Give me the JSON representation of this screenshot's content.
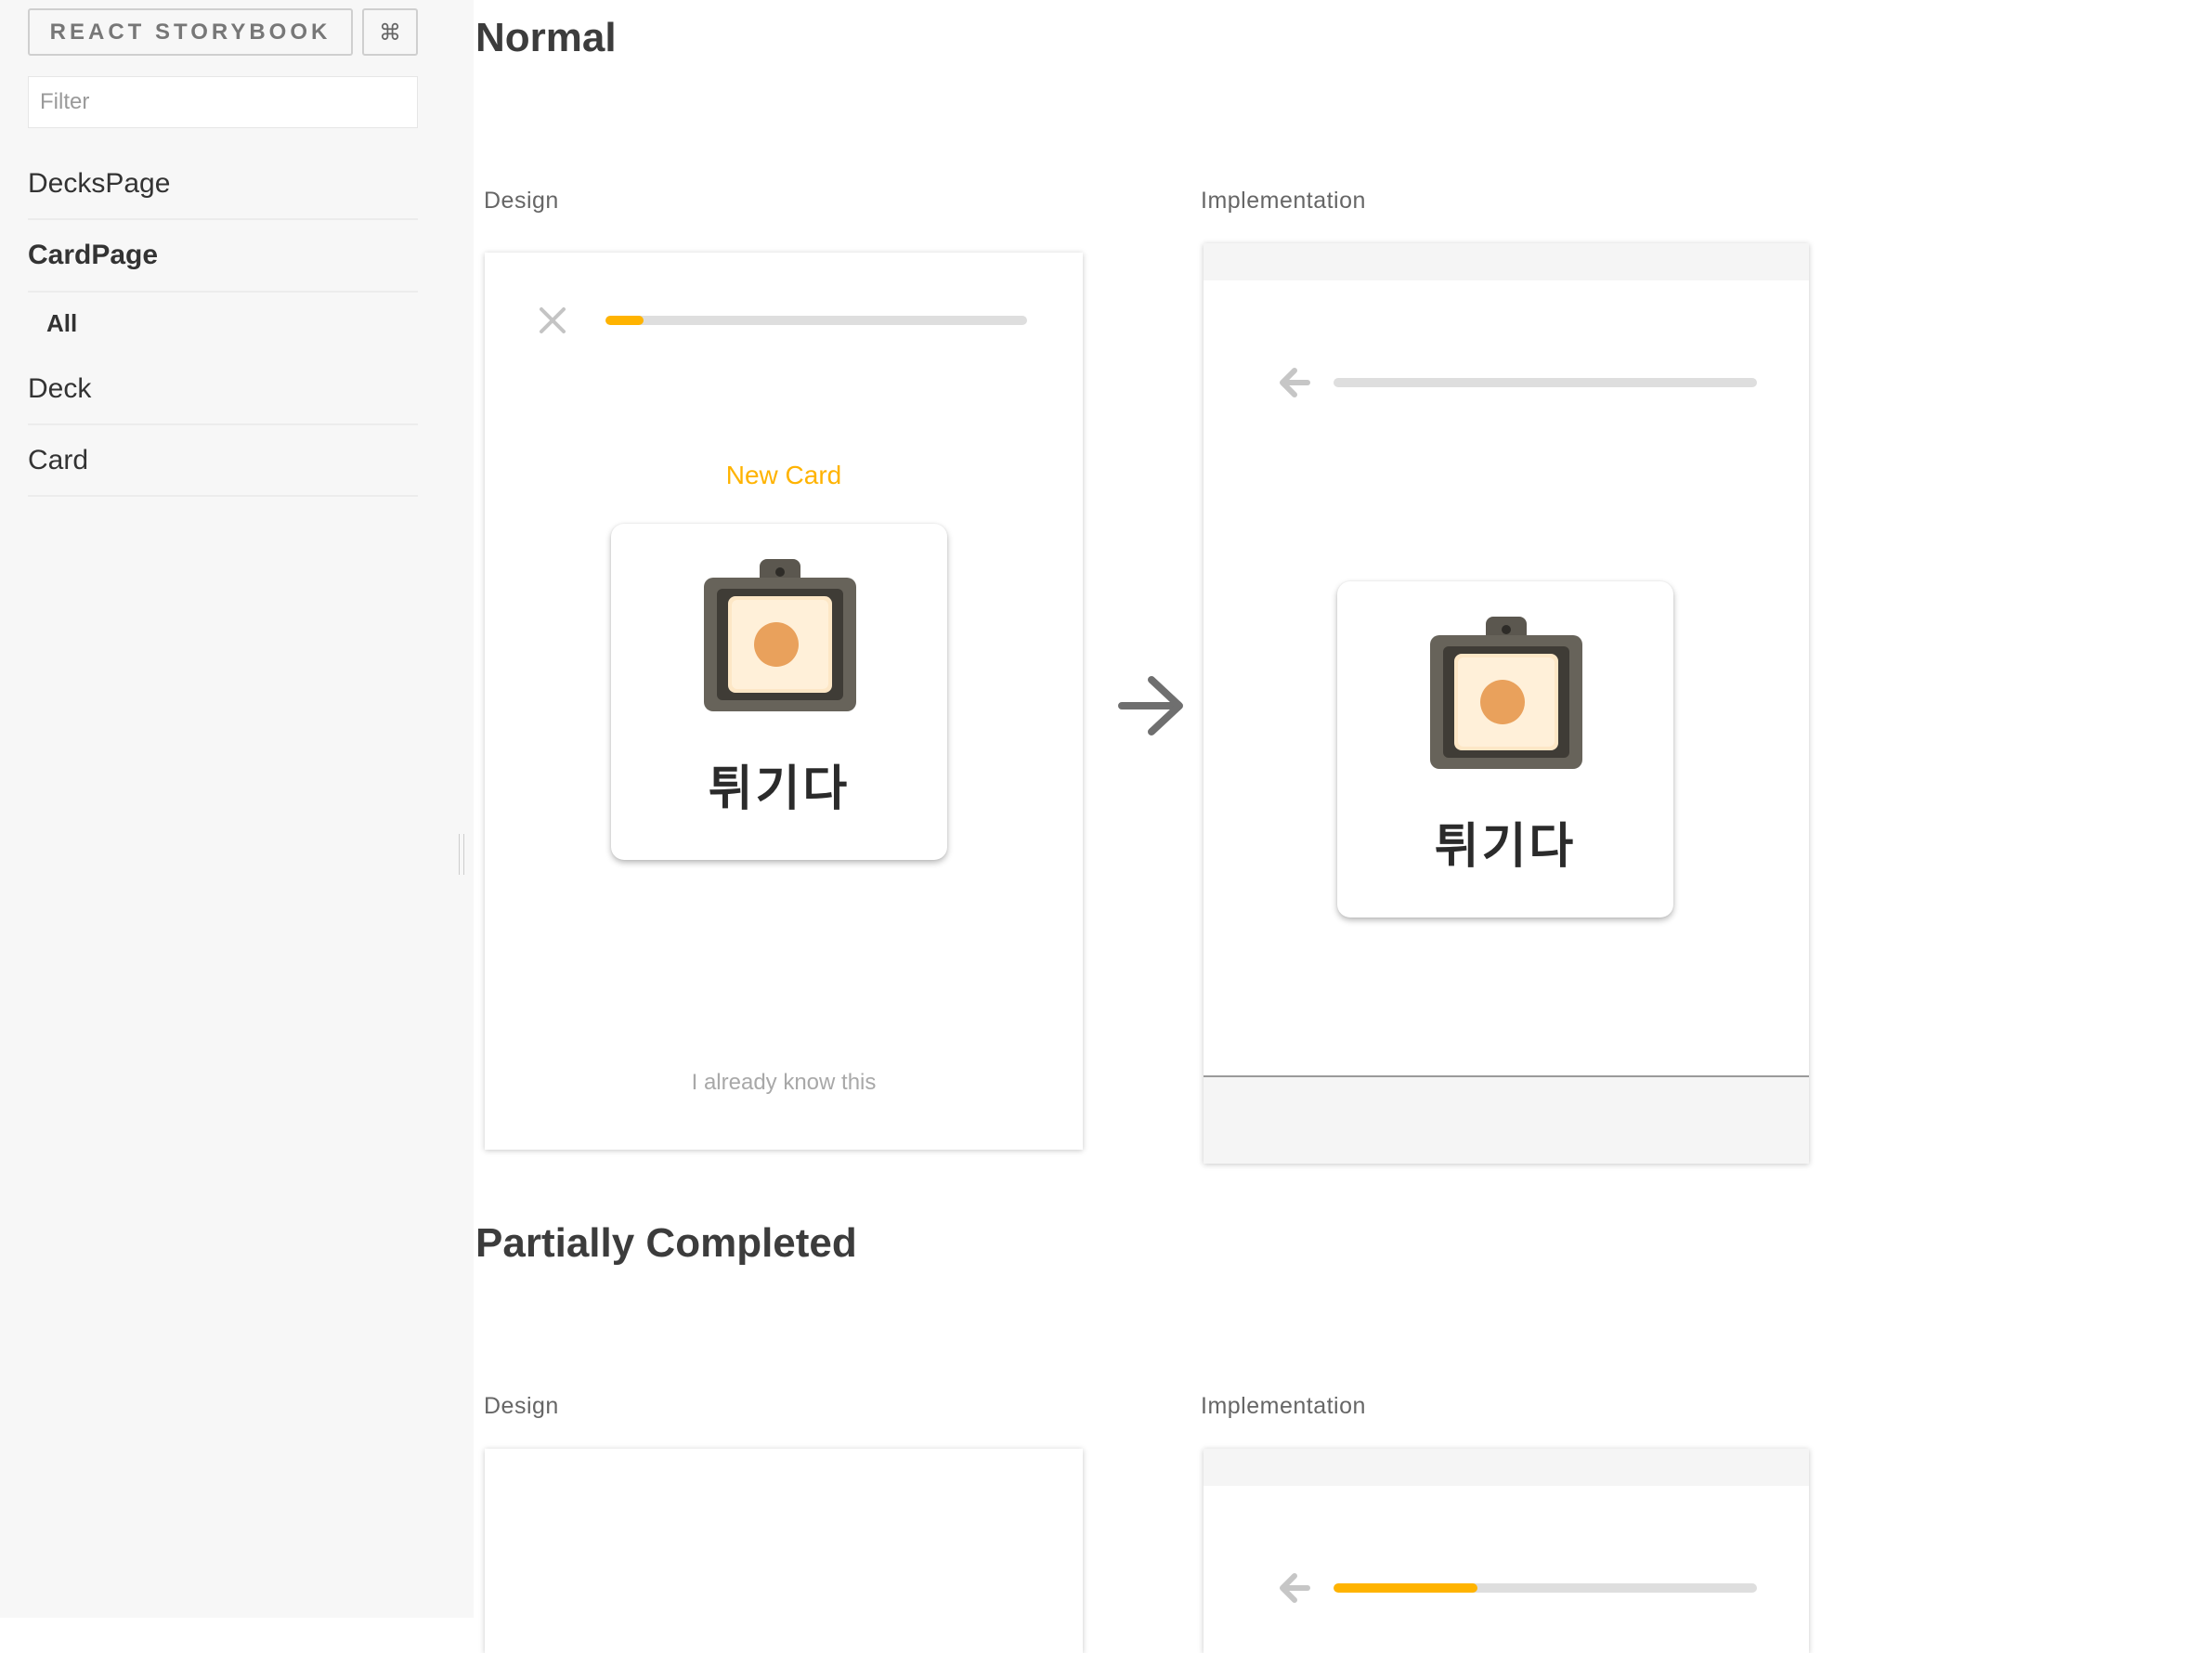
{
  "sidebar": {
    "brand": "REACT STORYBOOK",
    "shortcut_icon": "⌘",
    "filter_placeholder": "Filter",
    "items": [
      {
        "label": "DecksPage",
        "selected": false
      },
      {
        "label": "CardPage",
        "selected": true,
        "children": [
          {
            "label": "All",
            "selected": true
          }
        ]
      },
      {
        "label": "Deck",
        "selected": false
      },
      {
        "label": "Card",
        "selected": false
      }
    ]
  },
  "sections": [
    {
      "title": "Normal",
      "design_label": "Design",
      "implementation_label": "Implementation",
      "design": {
        "progress": 0.09,
        "badge": "New Card",
        "word": "튀기다",
        "link": "I already know this"
      },
      "implementation": {
        "progress": 0,
        "word": "튀기다"
      }
    },
    {
      "title": "Partially Completed",
      "design_label": "Design",
      "implementation_label": "Implementation",
      "implementation": {
        "progress": 0.34
      }
    }
  ],
  "icons": {
    "close": "close-icon",
    "back": "arrow-left-icon",
    "next": "arrow-right-icon",
    "card_image": "camera-device-image"
  },
  "colors": {
    "accent": "#FFB300",
    "track": "#DEDEDE",
    "sidebar_bg": "#F7F7F7"
  }
}
